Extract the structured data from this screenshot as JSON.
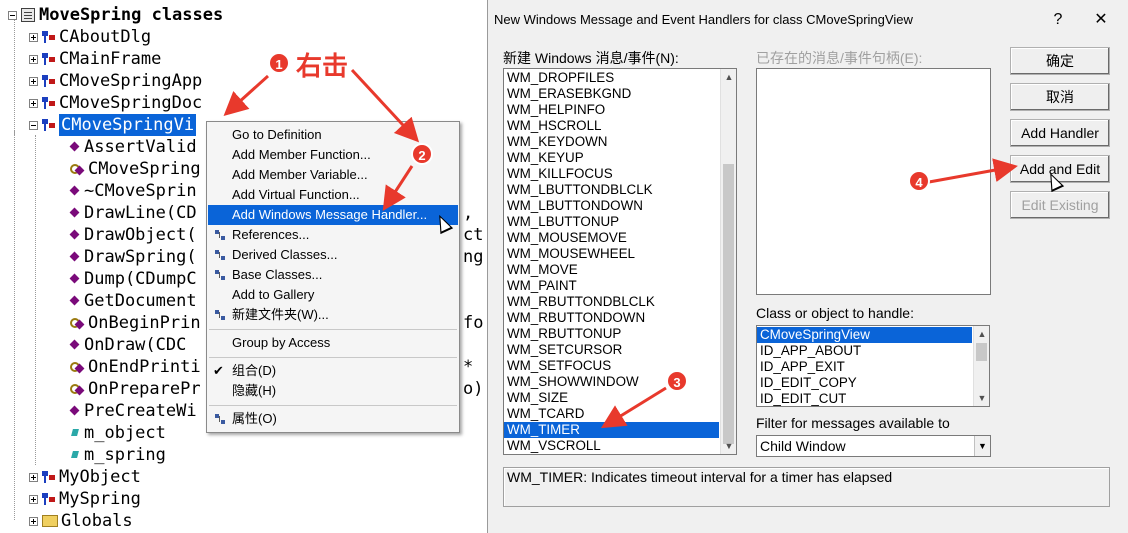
{
  "tree": {
    "root_label": "MoveSpring classes",
    "classes": [
      "CAboutDlg",
      "CMainFrame",
      "CMoveSpringApp",
      "CMoveSpringDoc"
    ],
    "selected_class": "CMoveSpringVi",
    "members": [
      {
        "label": "AssertValid",
        "icon": "function-icon"
      },
      {
        "label": "CMoveSpring",
        "icon": "constructor-icon"
      },
      {
        "label": "~CMoveSprin",
        "icon": "function-icon"
      },
      {
        "label": "DrawLine(CD",
        "icon": "function-icon"
      },
      {
        "label": "DrawObject(",
        "icon": "function-icon"
      },
      {
        "label": "DrawSpring(",
        "icon": "function-icon"
      },
      {
        "label": "Dump(CDumpC",
        "icon": "function-icon"
      },
      {
        "label": "GetDocument",
        "icon": "function-icon"
      },
      {
        "label": "OnBeginPrin",
        "icon": "constructor-icon"
      },
      {
        "label": "OnDraw(CDC",
        "icon": "function-icon"
      },
      {
        "label": "OnEndPrinti",
        "icon": "constructor-icon"
      },
      {
        "label": "OnPreparePr",
        "icon": "constructor-icon"
      },
      {
        "label": "PreCreateWi",
        "icon": "function-icon"
      },
      {
        "label": "m_object",
        "icon": "variable-icon"
      },
      {
        "label": "m_spring",
        "icon": "variable-icon"
      }
    ],
    "overflow_fragments": [
      {
        "text": ",",
        "row": 3
      },
      {
        "text": "ct",
        "row": 4
      },
      {
        "text": "ng",
        "row": 5
      },
      {
        "text": "fo",
        "row": 8
      },
      {
        "text": "*",
        "row": 10
      },
      {
        "text": "o)",
        "row": 11
      }
    ],
    "bottom_items": [
      "MyObject",
      "MySpring",
      "Globals"
    ]
  },
  "context_menu": {
    "items": [
      {
        "label": "Go to Definition",
        "icon": ""
      },
      {
        "label": "Add Member Function...",
        "icon": ""
      },
      {
        "label": "Add Member Variable...",
        "icon": ""
      },
      {
        "label": "Add Virtual Function...",
        "icon": ""
      },
      {
        "label": "Add Windows Message Handler...",
        "icon": "",
        "highlighted": true
      },
      {
        "label": "References...",
        "icon": "references-icon"
      },
      {
        "label": "Derived Classes...",
        "icon": "derived-classes-icon"
      },
      {
        "label": "Base Classes...",
        "icon": "base-classes-icon"
      },
      {
        "label": "Add to Gallery",
        "icon": ""
      },
      {
        "label": "新建文件夹(W)...",
        "icon": "new-folder-icon"
      },
      {
        "label": "Group by Access",
        "icon": ""
      },
      {
        "label": "组合(D)",
        "icon": "checkmark-icon"
      },
      {
        "label": "隐藏(H)",
        "icon": ""
      },
      {
        "label": "属性(O)",
        "icon": "properties-icon"
      }
    ]
  },
  "dialog": {
    "title": "New Windows Message and Event Handlers for class CMoveSpringView",
    "help_glyph": "?",
    "close_glyph": "✕",
    "messages_label": "新建 Windows 消息/事件(N):",
    "messages": [
      "WM_DROPFILES",
      "WM_ERASEBKGND",
      "WM_HELPINFO",
      "WM_HSCROLL",
      "WM_KEYDOWN",
      "WM_KEYUP",
      "WM_KILLFOCUS",
      "WM_LBUTTONDBLCLK",
      "WM_LBUTTONDOWN",
      "WM_LBUTTONUP",
      "WM_MOUSEMOVE",
      "WM_MOUSEWHEEL",
      "WM_MOVE",
      "WM_PAINT",
      "WM_RBUTTONDBLCLK",
      "WM_RBUTTONDOWN",
      "WM_RBUTTONUP",
      "WM_SETCURSOR",
      "WM_SETFOCUS",
      "WM_SHOWWINDOW",
      "WM_SIZE",
      "WM_TCARD",
      "WM_TIMER",
      "WM_VSCROLL"
    ],
    "selected_message": "WM_TIMER",
    "existing_label": "已存在的消息/事件句柄(E):",
    "class_label": "Class or object to handle:",
    "classes": [
      "CMoveSpringView",
      "ID_APP_ABOUT",
      "ID_APP_EXIT",
      "ID_EDIT_COPY",
      "ID_EDIT_CUT"
    ],
    "selected_class": "CMoveSpringView",
    "filter_label": "Filter for messages available to",
    "filter_value": "Child Window",
    "description": "WM_TIMER:  Indicates timeout interval for a timer has elapsed",
    "buttons": {
      "ok": "确定",
      "cancel": "取消",
      "add_handler": "Add Handler",
      "add_and_edit": "Add and Edit",
      "edit_existing": "Edit Existing"
    }
  },
  "annotations": {
    "right_click_text": "右击",
    "badges": [
      "1",
      "2",
      "3",
      "4"
    ],
    "color": "#e8392c"
  }
}
